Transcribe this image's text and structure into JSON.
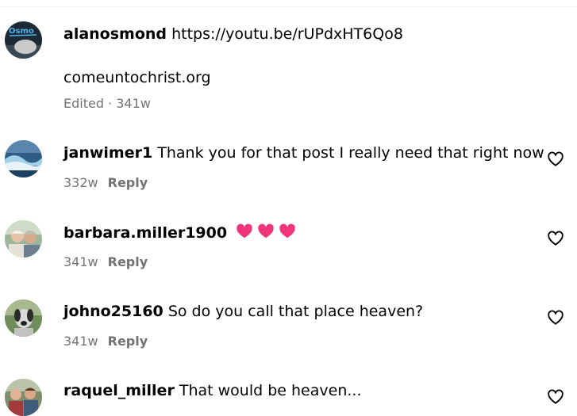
{
  "comments": [
    {
      "username": "alanosmond",
      "text": "https://youtu.be/rUPdxHT6Qo8",
      "extra": "comeuntochrist.org",
      "meta": "Edited · 341w",
      "avatar": "avatar-osmond-logo",
      "heart": false
    },
    {
      "username": "janwimer1",
      "text": "Thank you for that post I really need that right now",
      "age": "332w",
      "reply": "Reply",
      "avatar": "avatar-ocean-wave",
      "heart": true
    },
    {
      "username": "barbara.miller1900",
      "text": "",
      "emoji": [
        "heart-emoji",
        "heart-emoji",
        "heart-emoji"
      ],
      "age": "341w",
      "reply": "Reply",
      "avatar": "avatar-couple-photo",
      "heart": true
    },
    {
      "username": "johno25160",
      "text": "So do you call that place heaven?",
      "age": "341w",
      "reply": "Reply",
      "avatar": "avatar-dog-photo",
      "heart": true
    },
    {
      "username": "raquel_miller",
      "text": "That would be heaven...",
      "avatar": "avatar-family-photo",
      "heart": true
    }
  ],
  "colors": {
    "text": "#000000",
    "meta": "#737373",
    "emoji_heart": "#f0357a",
    "divider": "#efefef"
  },
  "icons": {
    "like": "heart-outline-icon",
    "emoji": "pink-heart-emoji"
  }
}
